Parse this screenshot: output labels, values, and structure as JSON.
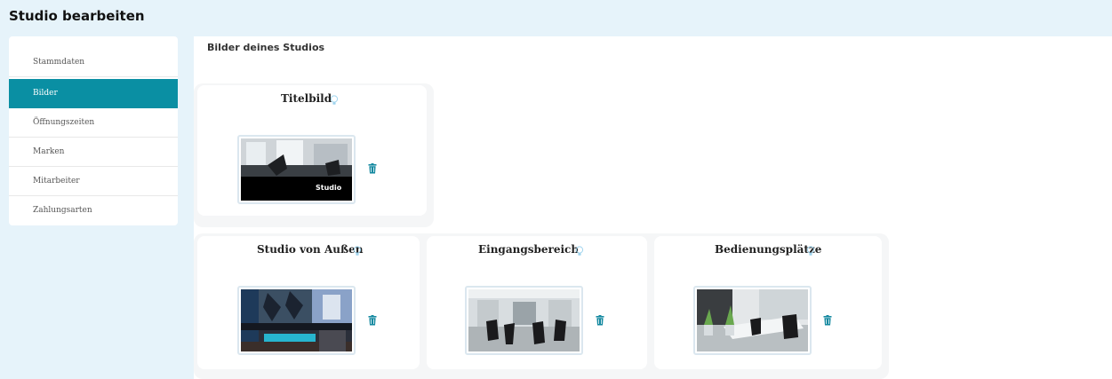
{
  "header": {
    "title": "Studio bearbeiten"
  },
  "sidebar": {
    "items": [
      {
        "label": "Stammdaten",
        "active": false
      },
      {
        "label": "Bilder",
        "active": true
      },
      {
        "label": "Öffnungszeiten",
        "active": false
      },
      {
        "label": "Marken",
        "active": false
      },
      {
        "label": "Mitarbeiter",
        "active": false
      },
      {
        "label": "Zahlungsarten",
        "active": false
      }
    ]
  },
  "main": {
    "section_title": "Bilder deines Studios",
    "cards": [
      {
        "title": "Titelbild",
        "photo_overlay_text": "Studio",
        "icon": "lightbulb-icon",
        "action_icon": "trash-icon"
      },
      {
        "title": "Studio von Außen",
        "icon": "lightbulb-icon",
        "action_icon": "trash-icon"
      },
      {
        "title": "Eingangsbereich",
        "icon": "lightbulb-icon",
        "action_icon": "trash-icon"
      },
      {
        "title": "Bedienungsplätze",
        "icon": "lightbulb-icon",
        "action_icon": "trash-icon"
      }
    ]
  },
  "colors": {
    "background": "#e6f3fa",
    "accent": "#0a8fa3",
    "trash": "#1489a0",
    "bulb": "#9fd4ee"
  }
}
